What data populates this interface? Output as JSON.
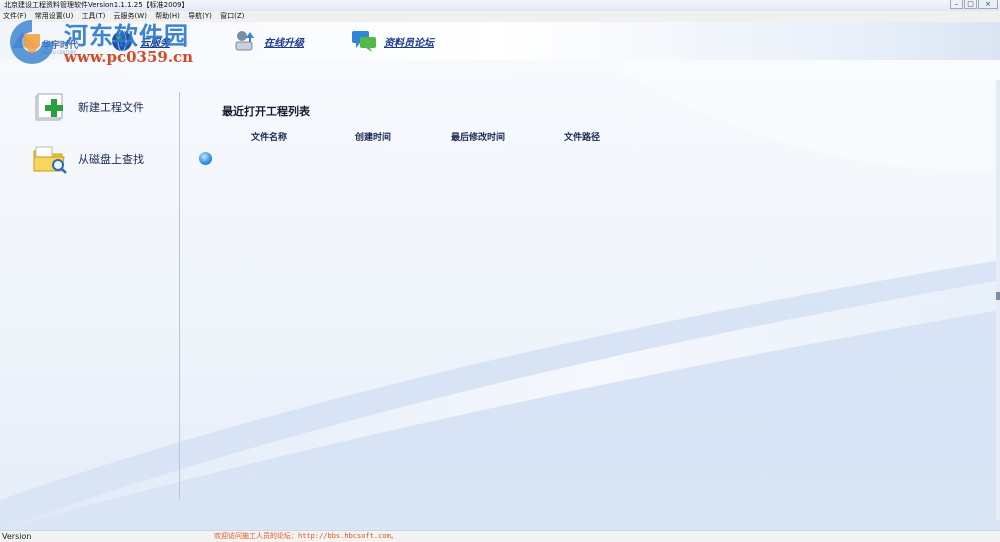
{
  "window": {
    "title": "北京建设工程资料管理软件Version1.1.1.25【标准2009】",
    "controls": [
      "–",
      "□",
      "×"
    ]
  },
  "menu": [
    "文件(F)",
    "常用设置(U)",
    "工具(T)",
    "云服务(W)",
    "帮助(H)",
    "导航(Y)",
    "窗口(Z)"
  ],
  "toolbar": {
    "logo_brand": "华宇时代",
    "logo_sub": "HUAYU CENTURY",
    "buttons": [
      {
        "label": "云服务",
        "icon": "globe-icon"
      },
      {
        "label": "在线升级",
        "icon": "upgrade-icon"
      },
      {
        "label": "资料员论坛",
        "icon": "forum-icon"
      }
    ]
  },
  "watermark": {
    "title": "河东软件园",
    "url": "www.pc0359.cn"
  },
  "left_panel": [
    {
      "label": "新建工程文件",
      "icon": "new-project-icon"
    },
    {
      "label": "从磁盘上查找",
      "icon": "folder-search-icon"
    }
  ],
  "recent": {
    "title": "最近打开工程列表",
    "columns": [
      "文件名称",
      "创建时间",
      "最后修改时间",
      "文件路径"
    ]
  },
  "status": {
    "left": "Version",
    "message": "欢迎访问施工人员的论坛：http://bbs.hbcsoft.com。"
  },
  "colors": {
    "accent": "#1a3a8a",
    "status_message": "#e0561c",
    "watermark_blue": "#2a77cc",
    "watermark_red": "#d44a27"
  }
}
